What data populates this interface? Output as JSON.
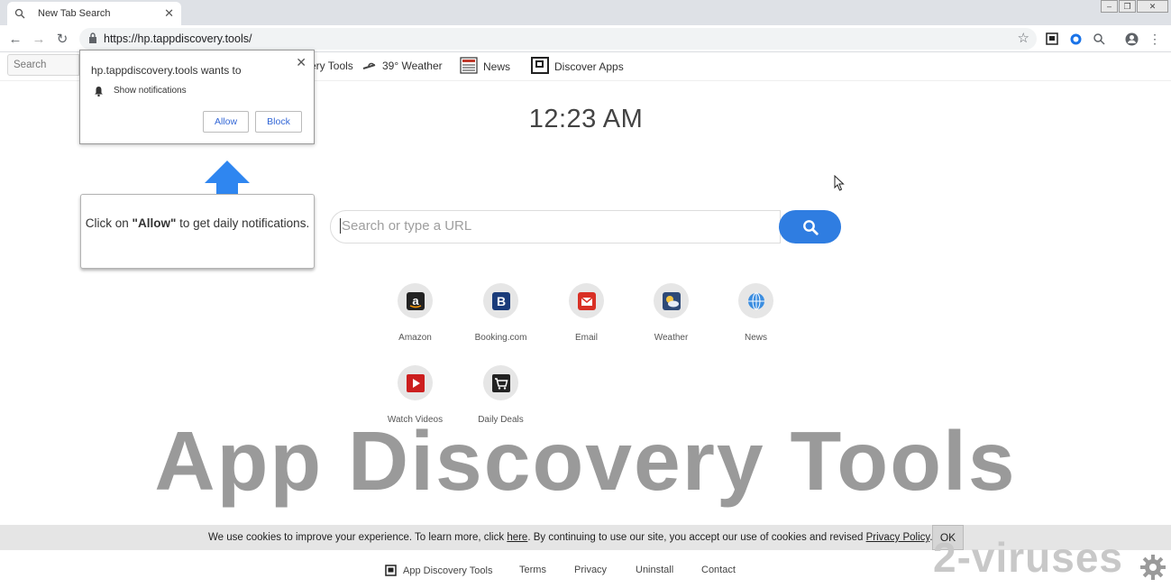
{
  "browser": {
    "tab_title": "New Tab Search",
    "url": "https://hp.tappdiscovery.tools/"
  },
  "page_header": {
    "search_placeholder": "Search",
    "links": [
      {
        "label": "ery Tools",
        "icon": "app-discovery-logo-icon"
      },
      {
        "label": "39° Weather",
        "icon": "weather-icon"
      },
      {
        "label": "News",
        "icon": "newspaper-icon"
      },
      {
        "label": "Discover Apps",
        "icon": "discover-apps-icon"
      }
    ]
  },
  "notification_popup": {
    "title": "hp.tappdiscovery.tools wants to",
    "permission": "Show notifications",
    "allow_label": "Allow",
    "block_label": "Block"
  },
  "callout": {
    "prefix": "Click on ",
    "emphasis": "\"Allow\"",
    "suffix": " to get daily notifications."
  },
  "clock": "12:23 AM",
  "main_search": {
    "placeholder": "Search or type a URL"
  },
  "tiles": [
    {
      "label": "Amazon",
      "icon": "amazon-icon"
    },
    {
      "label": "Booking.com",
      "icon": "booking-icon"
    },
    {
      "label": "Email",
      "icon": "email-icon"
    },
    {
      "label": "Weather",
      "icon": "weather-icon"
    },
    {
      "label": "News",
      "icon": "globe-icon"
    },
    {
      "label": "Watch Videos",
      "icon": "video-play-icon"
    },
    {
      "label": "Daily Deals",
      "icon": "shopping-cart-icon"
    }
  ],
  "watermark": "App Discovery Tools",
  "cookie_bar": {
    "text_1": "We use cookies to improve your experience. To learn more, click ",
    "link_here": "here",
    "text_2": ". By continuing to use our site, you accept our use of cookies and revised ",
    "link_privacy": "Privacy Policy",
    "text_3": ".",
    "ok_label": "OK"
  },
  "footer": {
    "links": [
      "App Discovery Tools",
      "Terms",
      "Privacy",
      "Uninstall",
      "Contact"
    ]
  },
  "site_mark": "2-viruses",
  "colors": {
    "accent": "#2f7de1",
    "watermark": "#9a9a9a"
  }
}
